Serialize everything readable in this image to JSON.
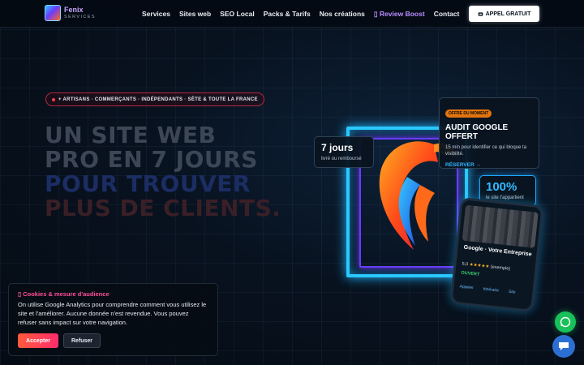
{
  "header": {
    "logo_name": "Fenix",
    "logo_sub": "SERVICES",
    "nav": [
      "Services",
      "Sites web",
      "SEO Local",
      "Packs & Tarifs",
      "Nos créations",
      "▯ Review Boost",
      "Contact"
    ],
    "cta": "APPEL GRATUIT",
    "cta_icon": "phone-icon"
  },
  "hero": {
    "pill": "+ ARTISANS · COMMERÇANTS · INDÉPENDANTS · SÈTE & TOUTE LA FRANCE",
    "headline_line1": "UN SITE WEB",
    "headline_line2": "PRO EN 7 JOURS",
    "headline_line3": "POUR TROUVER",
    "headline_line4": "PLUS DE CLIENTS."
  },
  "cards": {
    "days_title": "7 jours",
    "days_sub": "livré ou remboursé",
    "offer_tag": "OFFRE DU MOMENT",
    "offer_title": "AUDIT GOOGLE OFFERT",
    "offer_desc": "15 min pour identifier ce qui bloque ta visibilité.",
    "offer_link": "RÉSERVER →",
    "pct_title": "100%",
    "pct_sub": "le site t'appartient"
  },
  "phone": {
    "name": "Google · Votre Entreprise",
    "rating_value": "5,0",
    "rating_stars": "★★★★★",
    "rating_note": "(exemple)",
    "status": "OUVERT",
    "actions": [
      "Appeler",
      "Itinéraire",
      "Site"
    ]
  },
  "cookie": {
    "title": "▯ Cookies & mesure d'audience",
    "text": "On utilise Google Analytics pour comprendre comment vous utilisez le site et l'améliorer. Aucune donnée n'est revendue. Vous pouvez refuser sans impact sur votre navigation.",
    "accept": "Accepter",
    "refuse": "Refuser"
  },
  "colors": {
    "accent_blue": "#2ac8ff",
    "accent_purple": "#6a3cff",
    "cta_bg": "#ffffff",
    "accept_gradient": [
      "#ff5a3c",
      "#ff2d6b"
    ],
    "whatsapp": "#18c15a",
    "chat": "#2c6fd3"
  }
}
